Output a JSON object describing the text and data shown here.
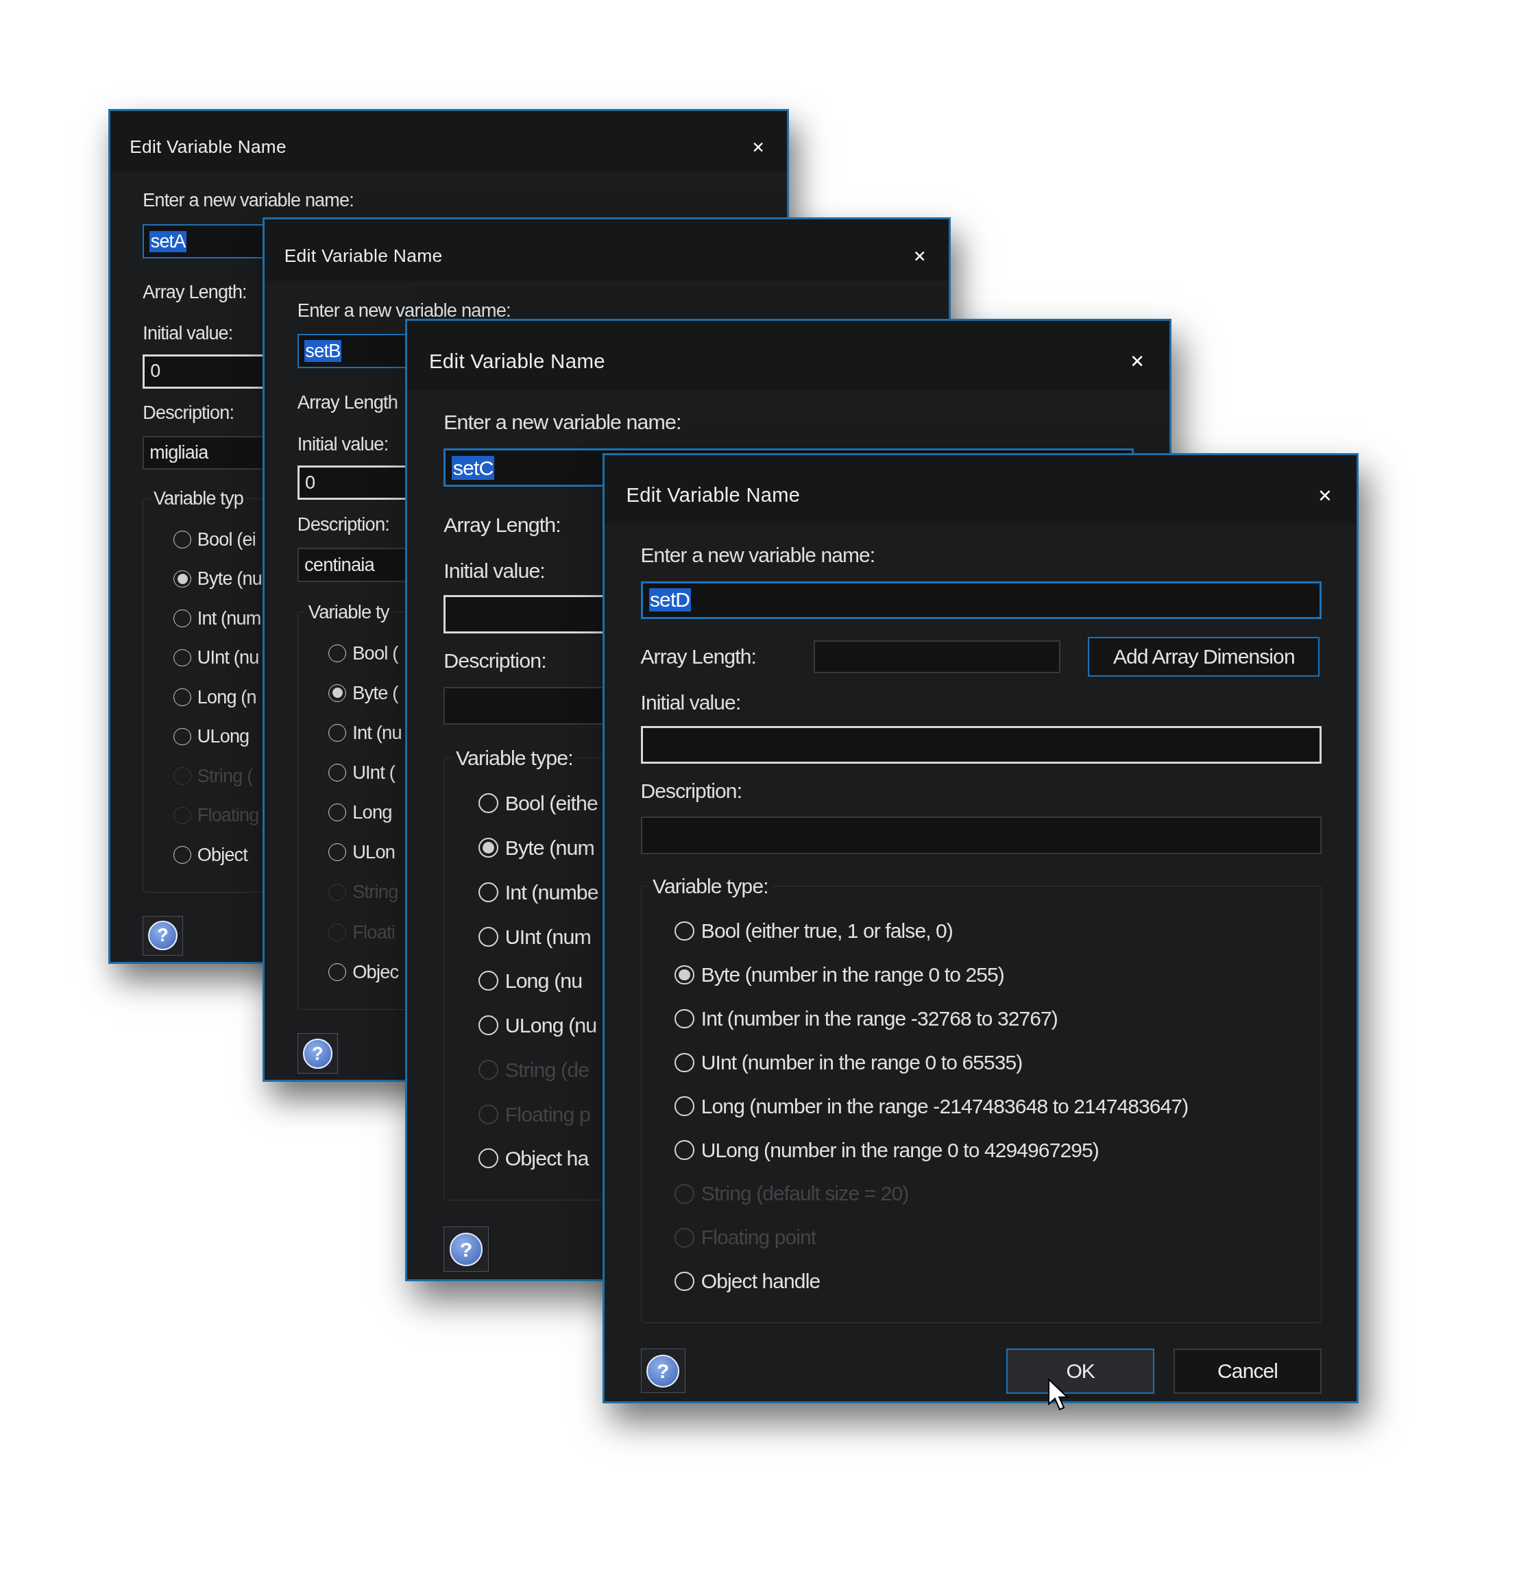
{
  "dialogs": [
    {
      "title": "Edit Variable Name",
      "close": "✕",
      "name_label": "Enter a new variable name:",
      "name_value": "setA",
      "array_length_label": "Array Length:",
      "initial_value_label": "Initial value:",
      "initial_value": "0",
      "description_label": "Description:",
      "description": "migliaia",
      "variable_type_label": "Variable typ",
      "types": [
        {
          "label": "Bool (ei",
          "selected": false,
          "disabled": false
        },
        {
          "label": "Byte (nu",
          "selected": true,
          "disabled": false
        },
        {
          "label": "Int (num",
          "selected": false,
          "disabled": false
        },
        {
          "label": "UInt (nu",
          "selected": false,
          "disabled": false
        },
        {
          "label": "Long (n",
          "selected": false,
          "disabled": false
        },
        {
          "label": "ULong",
          "selected": false,
          "disabled": false
        },
        {
          "label": "String (",
          "selected": false,
          "disabled": true
        },
        {
          "label": "Floating",
          "selected": false,
          "disabled": true
        },
        {
          "label": "Object",
          "selected": false,
          "disabled": false
        }
      ],
      "help": "?"
    },
    {
      "title": "Edit Variable Name",
      "close": "✕",
      "name_label": "Enter a new variable name:",
      "name_value": "setB",
      "array_length_label": "Array Length",
      "initial_value_label": "Initial value:",
      "initial_value": "0",
      "description_label": "Description:",
      "description": "centinaia",
      "variable_type_label": "Variable ty",
      "types": [
        {
          "label": "Bool (",
          "selected": false,
          "disabled": false
        },
        {
          "label": "Byte (",
          "selected": true,
          "disabled": false
        },
        {
          "label": "Int (nu",
          "selected": false,
          "disabled": false
        },
        {
          "label": "UInt (",
          "selected": false,
          "disabled": false
        },
        {
          "label": "Long",
          "selected": false,
          "disabled": false
        },
        {
          "label": "ULon",
          "selected": false,
          "disabled": false
        },
        {
          "label": "String",
          "selected": false,
          "disabled": true
        },
        {
          "label": "Floati",
          "selected": false,
          "disabled": true
        },
        {
          "label": "Objec",
          "selected": false,
          "disabled": false
        }
      ],
      "help": "?"
    },
    {
      "title": "Edit Variable Name",
      "close": "✕",
      "name_label": "Enter a new variable name:",
      "name_value": "setC",
      "array_length_label": "Array Length:",
      "initial_value_label": "Initial value:",
      "description_label": "Description:",
      "variable_type_label": "Variable type:",
      "types": [
        {
          "label": "Bool (eithe",
          "selected": false,
          "disabled": false
        },
        {
          "label": "Byte (num",
          "selected": true,
          "disabled": false
        },
        {
          "label": "Int (numbe",
          "selected": false,
          "disabled": false
        },
        {
          "label": "UInt (num",
          "selected": false,
          "disabled": false
        },
        {
          "label": "Long (nu",
          "selected": false,
          "disabled": false
        },
        {
          "label": "ULong (nu",
          "selected": false,
          "disabled": false
        },
        {
          "label": "String (de",
          "selected": false,
          "disabled": true
        },
        {
          "label": "Floating p",
          "selected": false,
          "disabled": true
        },
        {
          "label": "Object ha",
          "selected": false,
          "disabled": false
        }
      ],
      "help": "?"
    },
    {
      "title": "Edit Variable Name",
      "close": "✕",
      "name_label": "Enter a new variable name:",
      "name_value": "setD",
      "array_length_label": "Array Length:",
      "add_dimension_button": "Add Array Dimension",
      "initial_value_label": "Initial value:",
      "description_label": "Description:",
      "variable_type_label": "Variable type:",
      "types": [
        {
          "label": "Bool (either true, 1 or false, 0)",
          "selected": false,
          "disabled": false
        },
        {
          "label": "Byte (number in the range 0 to 255)",
          "selected": true,
          "disabled": false
        },
        {
          "label": "Int (number in the range -32768 to 32767)",
          "selected": false,
          "disabled": false
        },
        {
          "label": "UInt (number in the range 0 to 65535)",
          "selected": false,
          "disabled": false
        },
        {
          "label": "Long (number in the range -2147483648 to 2147483647)",
          "selected": false,
          "disabled": false
        },
        {
          "label": "ULong (number in the range 0 to 4294967295)",
          "selected": false,
          "disabled": false
        },
        {
          "label": "String (default size = 20)",
          "selected": false,
          "disabled": true
        },
        {
          "label": "Floating point",
          "selected": false,
          "disabled": true
        },
        {
          "label": "Object handle",
          "selected": false,
          "disabled": false
        }
      ],
      "help": "?",
      "buttons": [
        "OK",
        "Cancel"
      ]
    }
  ]
}
